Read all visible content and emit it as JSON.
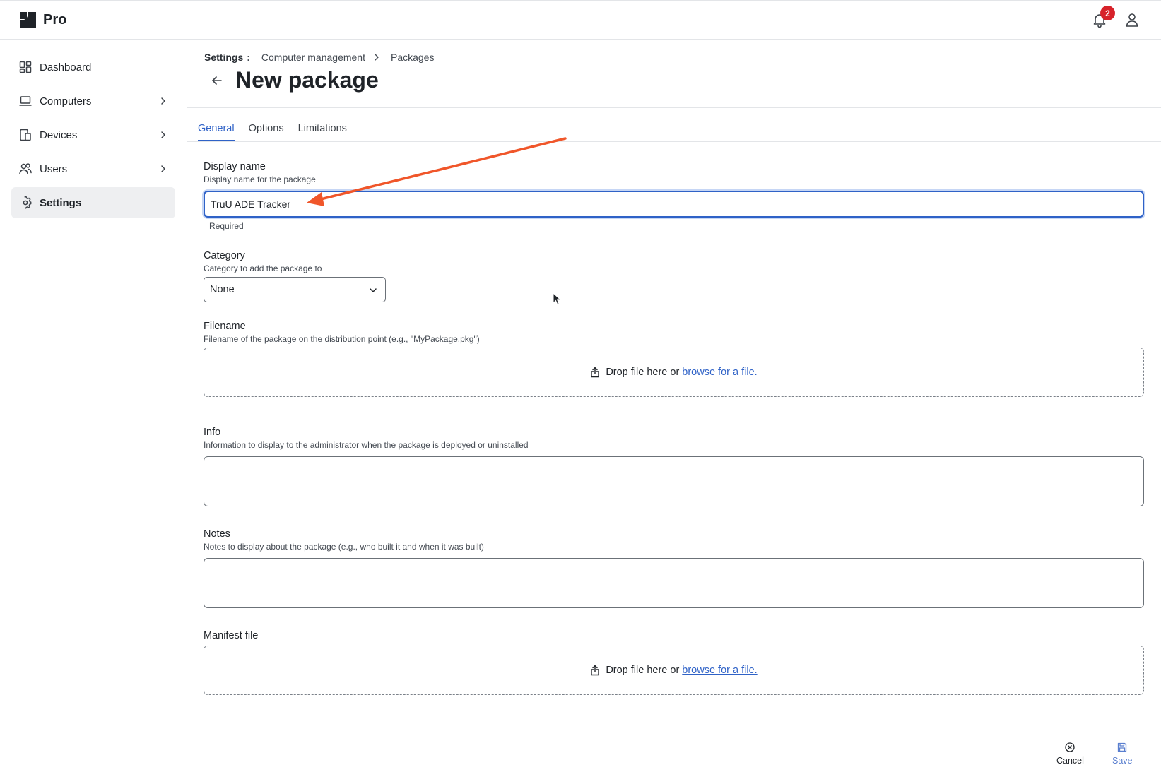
{
  "app": {
    "brand_name": "Pro",
    "notification_count": "2"
  },
  "sidebar": {
    "items": [
      {
        "label": "Dashboard",
        "icon": "dashboard-icon"
      },
      {
        "label": "Computers",
        "icon": "laptop-icon"
      },
      {
        "label": "Devices",
        "icon": "devices-icon"
      },
      {
        "label": "Users",
        "icon": "users-icon"
      },
      {
        "label": "Settings",
        "icon": "gear-icon",
        "active": true
      }
    ]
  },
  "header": {
    "breadcrumb_root": "Settings",
    "breadcrumb_colon": ":",
    "breadcrumb_1": "Computer management",
    "breadcrumb_2": "Packages",
    "title": "New package"
  },
  "tabs": [
    {
      "label": "General",
      "active": true
    },
    {
      "label": "Options"
    },
    {
      "label": "Limitations"
    }
  ],
  "form": {
    "display_name": {
      "label": "Display name",
      "help": "Display name for the package",
      "value": "TruU ADE Tracker",
      "hint": "Required"
    },
    "category": {
      "label": "Category",
      "help": "Category to add the package to",
      "value": "None"
    },
    "filename": {
      "label": "Filename",
      "help": "Filename of the package on the distribution point (e.g., \"MyPackage.pkg\")",
      "drop_text": "Drop file here or",
      "browse_text": "browse for a file."
    },
    "info": {
      "label": "Info",
      "help": "Information to display to the administrator when the package is deployed or uninstalled"
    },
    "notes": {
      "label": "Notes",
      "help": "Notes to display about the package (e.g., who built it and when it was built)"
    },
    "manifest": {
      "label": "Manifest file",
      "drop_text": "Drop file here or",
      "browse_text": "browse for a file."
    }
  },
  "actions": {
    "cancel_label": "Cancel",
    "save_label": "Save"
  },
  "colors": {
    "accent": "#2f62c7",
    "annotation_arrow": "#f0562a",
    "badge": "#d7222a"
  }
}
